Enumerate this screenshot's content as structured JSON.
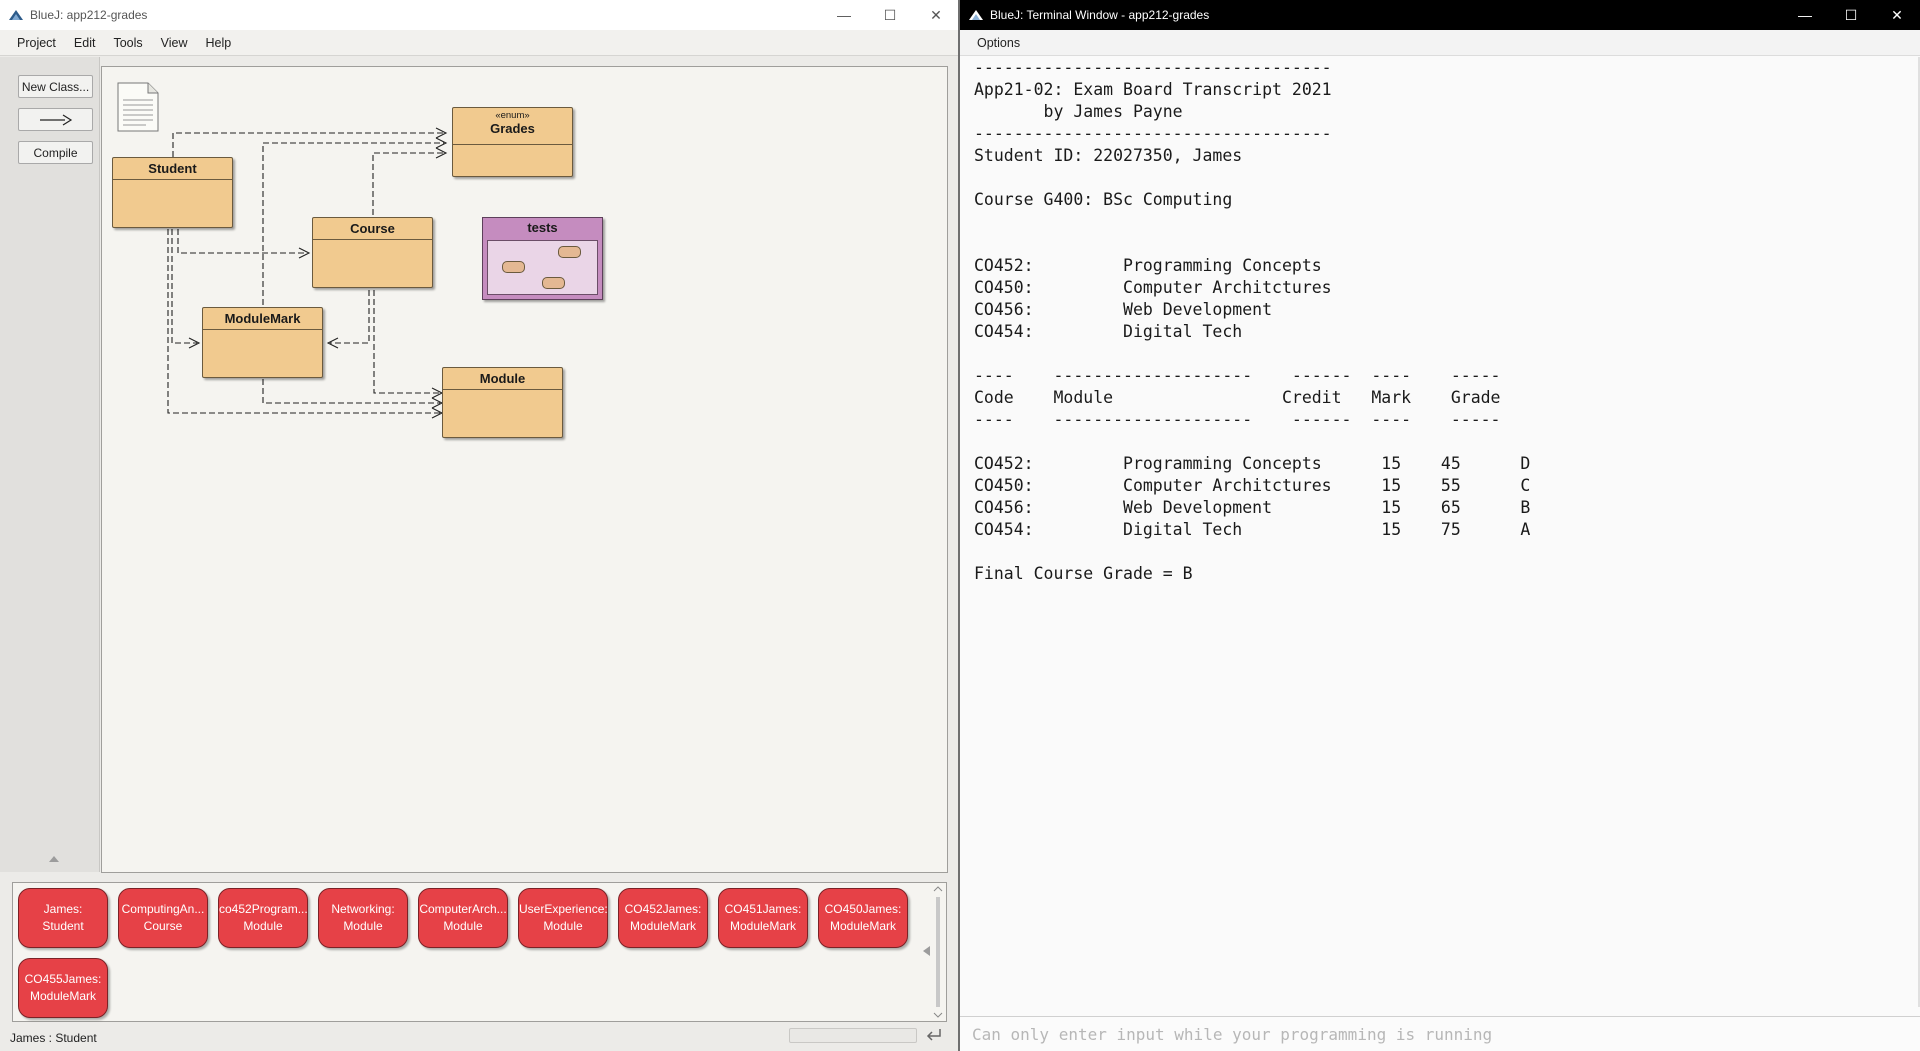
{
  "bluej": {
    "title": "BlueJ:  app212-grades",
    "menu": [
      "Project",
      "Edit",
      "Tools",
      "View",
      "Help"
    ],
    "tools": {
      "new_class": "New Class...",
      "compile": "Compile"
    },
    "classes": {
      "grades": {
        "stereotype": "«enum»",
        "name": "Grades"
      },
      "student": {
        "name": "Student"
      },
      "course": {
        "name": "Course"
      },
      "modulemark": {
        "name": "ModuleMark"
      },
      "module": {
        "name": "Module"
      },
      "tests": {
        "name": "tests"
      }
    },
    "objects": [
      {
        "line1": "James:",
        "line2": "Student"
      },
      {
        "line1": "ComputingAn...",
        "line2": "Course"
      },
      {
        "line1": "co452Program...",
        "line2": "Module"
      },
      {
        "line1": "Networking:",
        "line2": "Module"
      },
      {
        "line1": "ComputerArch...",
        "line2": "Module"
      },
      {
        "line1": "UserExperience:",
        "line2": "Module"
      },
      {
        "line1": "CO452James:",
        "line2": "ModuleMark"
      },
      {
        "line1": "CO451James:",
        "line2": "ModuleMark"
      },
      {
        "line1": "CO450James:",
        "line2": "ModuleMark"
      },
      {
        "line1": "CO455James:",
        "line2": "ModuleMark"
      }
    ],
    "status": "James : Student"
  },
  "terminal": {
    "title": "BlueJ: Terminal Window - app212-grades",
    "menu": "Options",
    "lines": [
      "------------------------------------",
      "App21-02: Exam Board Transcript 2021",
      "       by James Payne",
      "------------------------------------",
      "Student ID: 22027350, James",
      "",
      "Course G400: BSc Computing",
      "",
      "",
      "CO452:         Programming Concepts",
      "CO450:         Computer Architctures",
      "CO456:         Web Development",
      "CO454:         Digital Tech",
      "",
      "----    --------------------    ------  ----    -----",
      "Code    Module                 Credit   Mark    Grade",
      "----    --------------------    ------  ----    -----",
      "",
      "CO452:         Programming Concepts      15    45      D",
      "CO450:         Computer Architctures     15    55      C",
      "CO456:         Web Development           15    65      B",
      "CO454:         Digital Tech              15    75      A",
      "",
      "Final Course Grade = B"
    ],
    "input_placeholder": "Can only enter input while your programming is running"
  },
  "colors": {
    "class_fill": "#f1ca8f",
    "package_fill": "#c58cbf",
    "object_fill": "#e64147"
  }
}
